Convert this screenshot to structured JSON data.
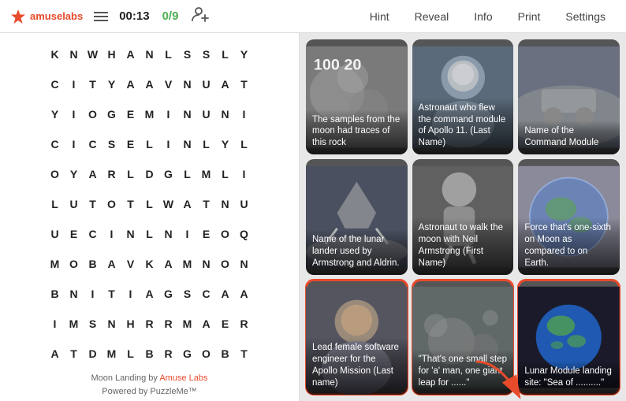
{
  "header": {
    "logo_text": "amuselabs",
    "timer": "00:13",
    "score": "0/9",
    "nav": {
      "hint": "Hint",
      "reveal": "Reveal",
      "info": "Info",
      "print": "Print",
      "settings": "Settings"
    }
  },
  "wordsearch": {
    "footer_line1": "Moon Landing by ",
    "footer_link": "Amuse Labs",
    "footer_line2": "Powered by ",
    "footer_trademark": "PuzzleMe™",
    "grid": [
      [
        "K",
        "N",
        "W",
        "H",
        "A",
        "N",
        "L",
        "S",
        "S",
        "L",
        "Y"
      ],
      [
        "C",
        "I",
        "T",
        "Y",
        "A",
        "A",
        "V",
        "N",
        "U",
        "A",
        "T"
      ],
      [
        "Y",
        "I",
        "O",
        "G",
        "E",
        "M",
        "I",
        "N",
        "U",
        "N",
        "I"
      ],
      [
        "C",
        "I",
        "C",
        "S",
        "E",
        "L",
        "I",
        "N",
        "L",
        "Y",
        "L"
      ],
      [
        "O",
        "Y",
        "A",
        "R",
        "L",
        "D",
        "G",
        "L",
        "M",
        "L",
        "I"
      ],
      [
        "L",
        "U",
        "T",
        "O",
        "T",
        "L",
        "W",
        "A",
        "T",
        "N",
        "U"
      ],
      [
        "U",
        "E",
        "C",
        "I",
        "N",
        "L",
        "N",
        "I",
        "E",
        "O",
        "Q"
      ],
      [
        "M",
        "O",
        "B",
        "A",
        "V",
        "K",
        "A",
        "M",
        "N",
        "O",
        "N"
      ],
      [
        "B",
        "N",
        "I",
        "T",
        "I",
        "A",
        "G",
        "S",
        "C",
        "A",
        "A"
      ],
      [
        "I",
        "M",
        "S",
        "N",
        "H",
        "R",
        "R",
        "M",
        "A",
        "E",
        "R"
      ],
      [
        "A",
        "T",
        "D",
        "M",
        "L",
        "B",
        "R",
        "G",
        "O",
        "B",
        "T"
      ]
    ]
  },
  "cards": [
    {
      "id": 1,
      "label": "The samples from the moon had traces of this rock",
      "number": "100 20",
      "bg_color": "#888",
      "highlighted": false
    },
    {
      "id": 2,
      "label": "Astronaut who flew the command module of Apollo 11. (Last Name)",
      "bg_color": "#666",
      "highlighted": false
    },
    {
      "id": 3,
      "label": "Name of the Command Module",
      "bg_color": "#777",
      "highlighted": false
    },
    {
      "id": 4,
      "label": "Name of the lunar lander used by Armstrong and Aldrin.",
      "bg_color": "#555",
      "highlighted": false
    },
    {
      "id": 5,
      "label": "Astronaut to walk the moon with Neil Armstrong (First Name)",
      "bg_color": "#666",
      "highlighted": false
    },
    {
      "id": 6,
      "label": "Force that's one-sixth on Moon as compared to on Earth.",
      "bg_color": "#999",
      "highlighted": false
    },
    {
      "id": 7,
      "label": "Lead female software engineer for the Apollo Mission (Last name)",
      "bg_color": "#555",
      "highlighted": true
    },
    {
      "id": 8,
      "label": "\"That's one small step for 'a' man, one giant leap for ......\"",
      "bg_color": "#666",
      "highlighted": true
    },
    {
      "id": 9,
      "label": "Lunar Module landing site: \"Sea of ..........\"",
      "bg_color": "#333",
      "highlighted": true
    }
  ],
  "colors": {
    "accent": "#e84b2c",
    "highlight_border": "#e84b2c"
  }
}
